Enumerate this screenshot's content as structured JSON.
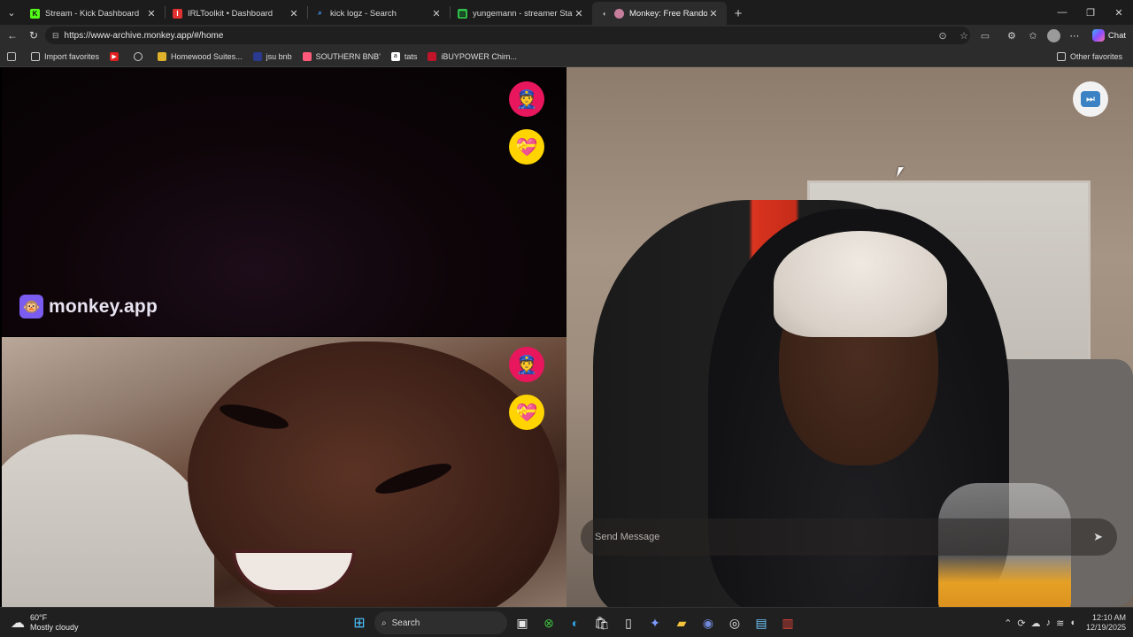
{
  "browser": {
    "tabs": [
      {
        "title": "Stream - Kick Dashboard",
        "favicon": "kick-icon",
        "color": "#53fc18",
        "active": false
      },
      {
        "title": "IRLToolkit • Dashboard",
        "favicon": "irltoolkit-icon",
        "color": "#e03131",
        "active": false
      },
      {
        "title": "kick logz - Search",
        "favicon": "search-icon",
        "color": "#4b9cff",
        "active": false
      },
      {
        "title": "yungemann - streamer Statistics",
        "favicon": "stats-icon",
        "color": "#2fbf4a",
        "active": false
      },
      {
        "title": "Monkey: Free Random Video",
        "favicon": "monkey-icon",
        "color": "#c77d9c",
        "active": true
      }
    ],
    "url": "https://www-archive.monkey.app/#/home",
    "chat_label": "Chat",
    "favorites": [
      {
        "label": "Import favorites",
        "icon": "folder-icon"
      },
      {
        "label": "",
        "icon": "youtube-icon"
      },
      {
        "label": "",
        "icon": "globe-icon"
      },
      {
        "label": "Homewood Suites...",
        "icon": "hotel-icon"
      },
      {
        "label": "jsu bnb",
        "icon": "jsu-icon"
      },
      {
        "label": "SOUTHERN BNB'",
        "icon": "airbnb-icon"
      },
      {
        "label": "tats",
        "icon": "amazon-icon"
      },
      {
        "label": "iBUYPOWER Chim...",
        "icon": "ibuypower-icon"
      }
    ],
    "other_favorites": "Other favorites"
  },
  "app": {
    "brand": "monkey.app",
    "message_placeholder": "Send Message",
    "accent_police": "#e8175d",
    "accent_heart": "#ffd400"
  },
  "taskbar": {
    "temperature": "60°F",
    "condition": "Mostly cloudy",
    "search_label": "Search",
    "time": "12:10 AM",
    "date": "12/19/2025"
  }
}
